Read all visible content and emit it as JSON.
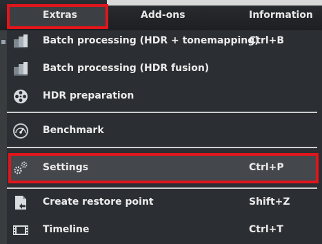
{
  "menubar": {
    "tabs": [
      {
        "label": "Extras",
        "active": true
      },
      {
        "label": "Add-ons",
        "active": false
      },
      {
        "label": "Information",
        "active": false
      }
    ]
  },
  "menu": {
    "items": [
      {
        "label": "Batch processing (HDR + tonemapping)",
        "shortcut": "Ctrl+B",
        "icon": "batch-processing-icon"
      },
      {
        "label": "Batch processing (HDR fusion)",
        "shortcut": "",
        "icon": "batch-fusion-icon"
      },
      {
        "label": "HDR preparation",
        "shortcut": "",
        "icon": "film-reel-icon"
      },
      {
        "label": "Benchmark",
        "shortcut": "",
        "icon": "speedometer-icon"
      },
      {
        "label": "Settings",
        "shortcut": "Ctrl+P",
        "icon": "gears-icon",
        "highlighted": true
      },
      {
        "label": "Create restore point",
        "shortcut": "Shift+Z",
        "icon": "restore-point-icon"
      },
      {
        "label": "Timeline",
        "shortcut": "Ctrl+T",
        "icon": "timeline-icon"
      }
    ]
  },
  "colors": {
    "highlight_border": "#e0161c",
    "menu_background": "#2b2e32",
    "text": "#ececec"
  }
}
